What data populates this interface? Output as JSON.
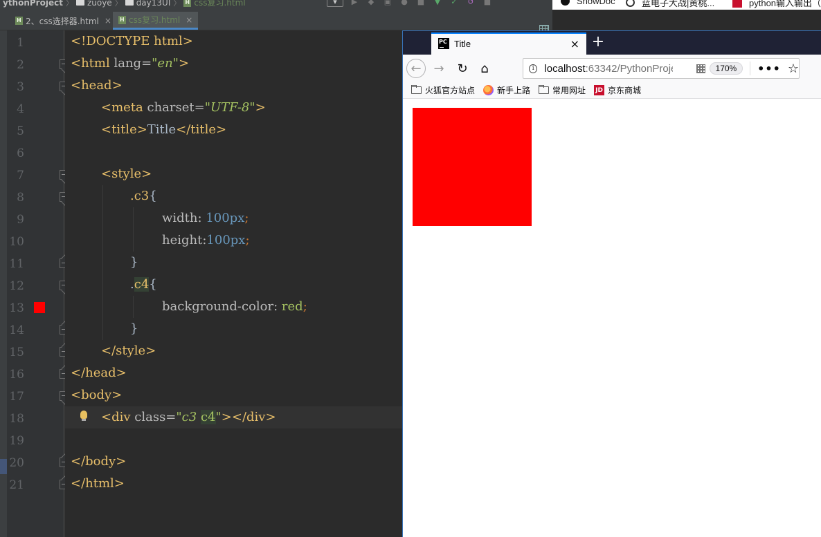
{
  "ide": {
    "breadcrumbs": [
      "ythonProject",
      "zuoye",
      "day13UI",
      "css复习.html"
    ],
    "tabs": [
      {
        "label": "2、css选择器.html",
        "close": "×",
        "active": false
      },
      {
        "label": "css复习.html",
        "close": "×",
        "active": true
      }
    ],
    "line_numbers": [
      "1",
      "2",
      "3",
      "4",
      "5",
      "6",
      "7",
      "8",
      "9",
      "10",
      "11",
      "12",
      "13",
      "14",
      "15",
      "16",
      "17",
      "18",
      "19",
      "20",
      "21"
    ],
    "code": {
      "l1": {
        "a": "<!DOCTYPE html>"
      },
      "l2": {
        "a": "<html ",
        "b": "lang=",
        "c": "\"en\"",
        "d": ">"
      },
      "l3": {
        "a": "<head>"
      },
      "l4": {
        "a": "<meta ",
        "b": "charset=",
        "c": "\"UTF-8\"",
        "d": ">"
      },
      "l5": {
        "a": "<title>",
        "b": "Title",
        "c": "</title>"
      },
      "l7": {
        "a": "<style>"
      },
      "l8": {
        "a": ".c3",
        "b": "{"
      },
      "l9": {
        "a": "width: ",
        "b": "100px",
        "c": ";"
      },
      "l10": {
        "a": "height:",
        "b": "100px",
        "c": ";"
      },
      "l11": {
        "a": "}"
      },
      "l12": {
        "a": ".",
        "b": "c4",
        "c": "{"
      },
      "l13": {
        "a": "background-color: ",
        "b": "red",
        "c": ";"
      },
      "l14": {
        "a": "}"
      },
      "l15": {
        "a": "</style>"
      },
      "l16": {
        "a": "</head>"
      },
      "l17": {
        "a": "<body>"
      },
      "l18": {
        "a": "<div ",
        "b": "class=",
        "c": "\"c3 ",
        "d": "c4",
        "e": "\"",
        "f": "></div>"
      },
      "l20": {
        "a": "</body>"
      },
      "l21": {
        "a": "</html>"
      }
    },
    "color_swatch": "#ff0000"
  },
  "top_bookmarks": [
    {
      "label": "ShowDoc",
      "icon": "showdoc-icon"
    },
    {
      "label": "蓝电子大战|黄桃...",
      "icon": "search-icon"
    },
    {
      "label": "python输入输出（",
      "icon": "csdn-icon"
    }
  ],
  "browser": {
    "tab_icon_text": "PC",
    "tab_title": "Title",
    "tab_close": "×",
    "new_tab": "+",
    "url_host": "localhost",
    "url_rest": ":63342/PythonProje",
    "zoom": "170%",
    "nav": {
      "back": "←",
      "forward": "→",
      "reload": "↻",
      "home": "⌂",
      "more": "•••",
      "star": "☆",
      "info": "i"
    },
    "bookmarks": [
      {
        "label": "火狐官方站点",
        "icon": "folder-icon"
      },
      {
        "label": "新手上路",
        "icon": "firefox-icon"
      },
      {
        "label": "常用网址",
        "icon": "folder-icon"
      },
      {
        "label": "京东商城",
        "icon": "jd-icon"
      }
    ],
    "jd_icon_text": "JD",
    "content_box_color": "#ff0000"
  }
}
